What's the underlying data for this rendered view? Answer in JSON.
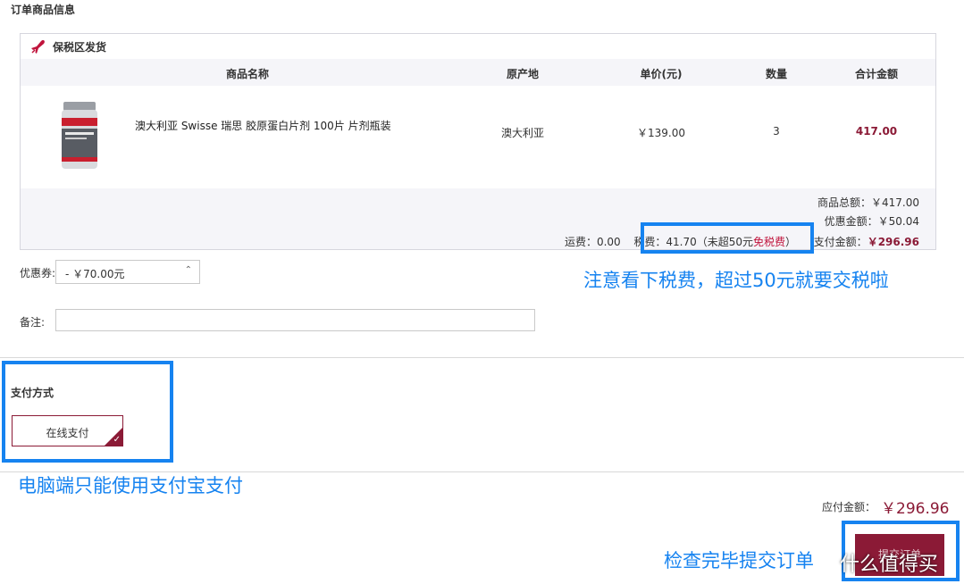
{
  "section_title": "订单商品信息",
  "bonded": {
    "label": "保税区发货",
    "icon": "plane-icon"
  },
  "columns": [
    "商品名称",
    "原产地",
    "单价(元)",
    "数量",
    "合计金额"
  ],
  "product": {
    "name": "澳大利亚 Swisse 瑞思 胶原蛋白片剂 100片 片剂瓶装",
    "origin": "澳大利亚",
    "unit_price": "￥139.00",
    "quantity": "3",
    "subtotal": "417.00",
    "image_text": "Swisse"
  },
  "summary": {
    "goods_total": "商品总额：￥417.00",
    "discount": "优惠金额：￥50.04",
    "shipping": "运费：0.00",
    "tax_prefix": "税费：41.70（未超50元",
    "tax_free": "免税费",
    "tax_suffix": "）",
    "pay_label": "支付金额：",
    "pay_amount": "￥296.96"
  },
  "coupon": {
    "label": "优惠券:",
    "value": "- ￥70.00元"
  },
  "note": {
    "label": "备注:",
    "value": ""
  },
  "payment": {
    "title": "支付方式",
    "option": "在线支付"
  },
  "payable": {
    "label": "应付金额：",
    "amount": "￥296.96"
  },
  "submit": {
    "label": "提交订单"
  },
  "annotations": {
    "tax_note": "注意看下税费，超过50元就要交税啦",
    "pay_note": "电脑端只能使用支付宝支付",
    "submit_note": "检查完毕提交订单"
  },
  "watermark": "什么值得买",
  "colors": {
    "accent": "#8b1a36",
    "annotation_blue": "#1683f0"
  }
}
